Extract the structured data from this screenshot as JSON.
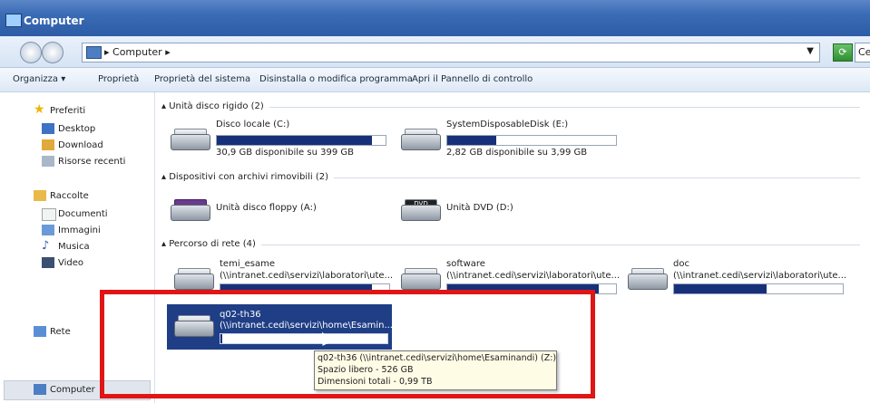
{
  "window": {
    "title": "Computer"
  },
  "address": {
    "path": "▸ Computer ▸",
    "search_placeholder": "Cer"
  },
  "toolbar": {
    "organize": "Organizza ▾",
    "properties": "Proprietà",
    "system_properties": "Proprietà del sistema",
    "uninstall": "Disinstalla o modifica programma",
    "control_panel": "Apri il Pannello di controllo"
  },
  "nav": {
    "favorites": "Preferiti",
    "desktop": "Desktop",
    "download": "Download",
    "recent": "Risorse recenti",
    "libraries": "Raccolte",
    "documents": "Documenti",
    "images": "Immagini",
    "music": "Musica",
    "video": "Video",
    "computer": "Computer",
    "network": "Rete"
  },
  "groups": {
    "hdd": "▴ Unità disco rigido (2)",
    "removable": "▴ Dispositivi con archivi rimovibili (2)",
    "network": "▴ Percorso di rete (4)"
  },
  "drives": {
    "c": {
      "name": "Disco locale (C:)",
      "free": "30,9 GB disponibile su 399 GB",
      "used_fraction": 0.92
    },
    "e": {
      "name": "SystemDisposableDisk (E:)",
      "free": "2,82 GB disponibile su 3,99 GB",
      "used_fraction": 0.29
    },
    "a": {
      "name": "Unità disco floppy (A:)"
    },
    "d": {
      "name": "Unità DVD (D:)",
      "badge": "DVD"
    },
    "temi": {
      "name": "temi_esame",
      "path": "(\\\\intranet.cedi\\servizi\\laboratori\\ute...",
      "used_fraction": 0.9
    },
    "software": {
      "name": "software",
      "path": "(\\\\intranet.cedi\\servizi\\laboratori\\ute...",
      "used_fraction": 0.9
    },
    "doc": {
      "name": "doc",
      "path": "(\\\\intranet.cedi\\servizi\\laboratori\\ute...",
      "used_fraction": 0.55
    },
    "q02": {
      "name": "q02-th36",
      "path": "(\\\\intranet.cedi\\servizi\\home\\Esamin...",
      "used_fraction": 0.01
    }
  },
  "tooltip": {
    "line1": "q02-th36 (\\\\intranet.cedi\\servizi\\home\\Esaminandi) (Z:)",
    "line2": "Spazio libero - 526 GB",
    "line3": "Dimensioni totali - 0,99 TB"
  },
  "colors": {
    "accent": "#1f3e86",
    "highlight": "#e01515",
    "bar": "#16307a"
  }
}
